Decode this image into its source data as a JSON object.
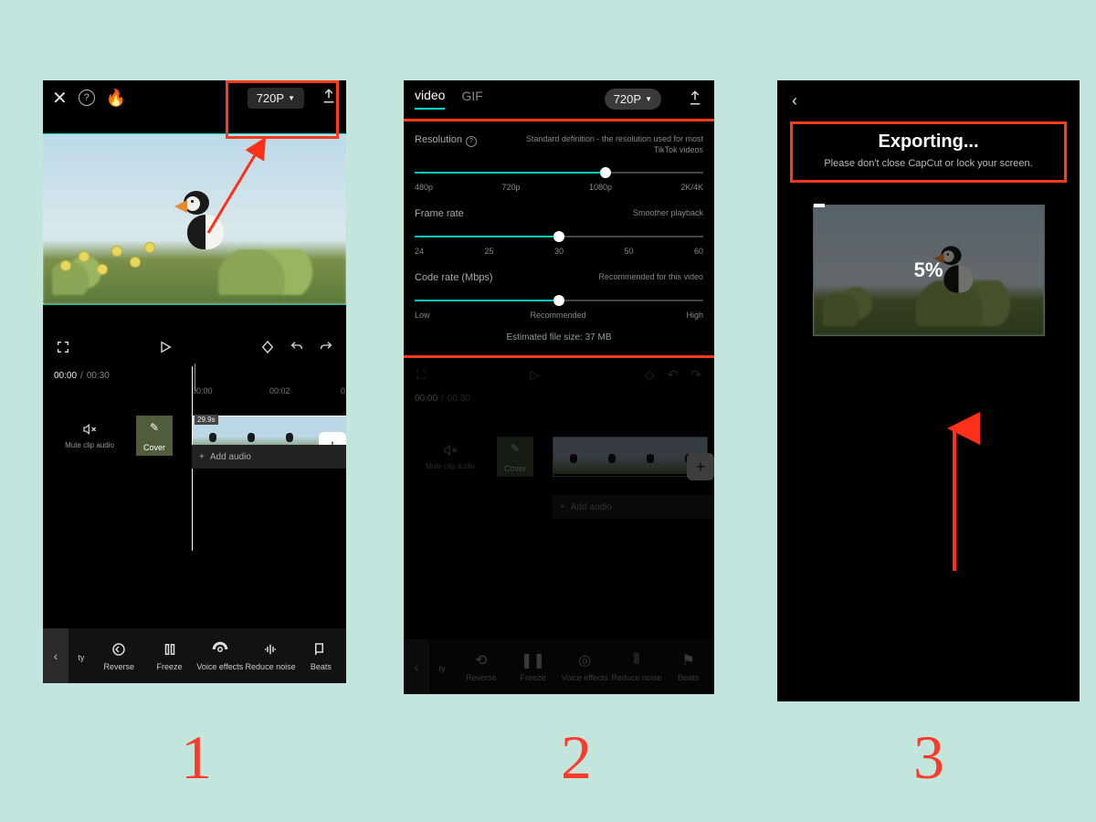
{
  "steps": {
    "one": "1",
    "two": "2",
    "three": "3"
  },
  "p1": {
    "quality": "720P",
    "time_current": "00:00",
    "time_total": "00:30",
    "ticks": [
      "00:00",
      "00:02",
      "0"
    ],
    "mute_label": "Mute clip audio",
    "cover_label": "Cover",
    "clip_duration": "29.9s",
    "add_audio": "Add audio",
    "tools": {
      "t0": "ty",
      "reverse": "Reverse",
      "freeze": "Freeze",
      "voice": "Voice effects",
      "noise": "Reduce noise",
      "beats": "Beats"
    }
  },
  "p2": {
    "tab_video": "video",
    "tab_gif": "GIF",
    "quality": "720P",
    "res": {
      "label": "Resolution",
      "desc": "Standard definition - the resolution used for most TikTok videos",
      "opts": [
        "480p",
        "720p",
        "1080p",
        "2K/4K"
      ]
    },
    "fps": {
      "label": "Frame rate",
      "desc": "Smoother playback",
      "opts": [
        "24",
        "25",
        "30",
        "50",
        "60"
      ]
    },
    "rate": {
      "label": "Code rate (Mbps)",
      "desc": "Recommended for this video",
      "opts": [
        "Low",
        "Recommended",
        "High"
      ]
    },
    "estimate": "Estimated file size: 37 MB",
    "time_current": "00:00",
    "time_total": "00:30",
    "mute_label": "Mute clip audio",
    "cover_label": "Cover",
    "add_audio": "Add audio",
    "tools": {
      "t0": "ty",
      "reverse": "Reverse",
      "freeze": "Freeze",
      "voice": "Voice effects",
      "noise": "Reduce noise",
      "beats": "Beats"
    }
  },
  "p3": {
    "title": "Exporting...",
    "subtitle": "Please don't close CapCut or lock your screen.",
    "percent": "5%"
  }
}
